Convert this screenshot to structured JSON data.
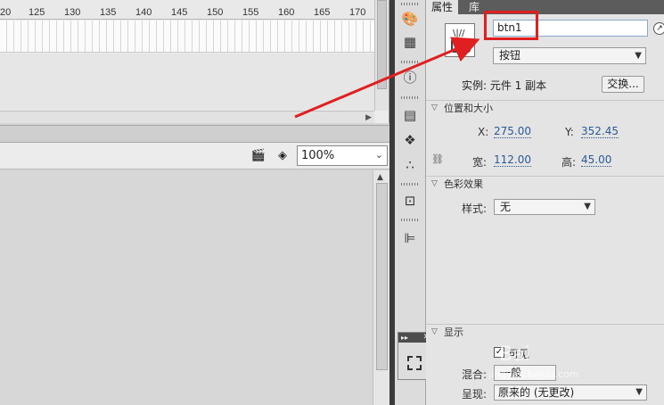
{
  "timeline": {
    "ruler_labels": [
      "20",
      "125",
      "130",
      "135",
      "140",
      "145",
      "150",
      "155",
      "160",
      "165",
      "170"
    ]
  },
  "stage": {
    "zoom_value": "100%"
  },
  "properties": {
    "tabs": [
      "属性",
      "库"
    ],
    "instance_name": "btn1",
    "symbol_type": "按钮",
    "instance_of_label": "实例: 元件 1 副本",
    "swap_button": "交换...",
    "position_size": {
      "header": "位置和大小",
      "x_label": "X:",
      "x_value": "275.00",
      "y_label": "Y:",
      "y_value": "352.45",
      "w_label": "宽:",
      "w_value": "112.00",
      "h_label": "高:",
      "h_value": "45.00"
    },
    "color_effect": {
      "header": "色彩效果",
      "style_label": "样式:",
      "style_value": "无"
    },
    "display": {
      "header": "显示",
      "visible_label": "可见",
      "blend_label": "混合:",
      "blend_value": "一般",
      "render_label": "呈现:",
      "render_value": "原来的 (无更改)"
    }
  },
  "watermark": {
    "text": "Bai",
    "url": "jingyan.baidu.com"
  },
  "colors": {
    "annotation": "#e02020",
    "value_blue": "#2a5a96"
  }
}
